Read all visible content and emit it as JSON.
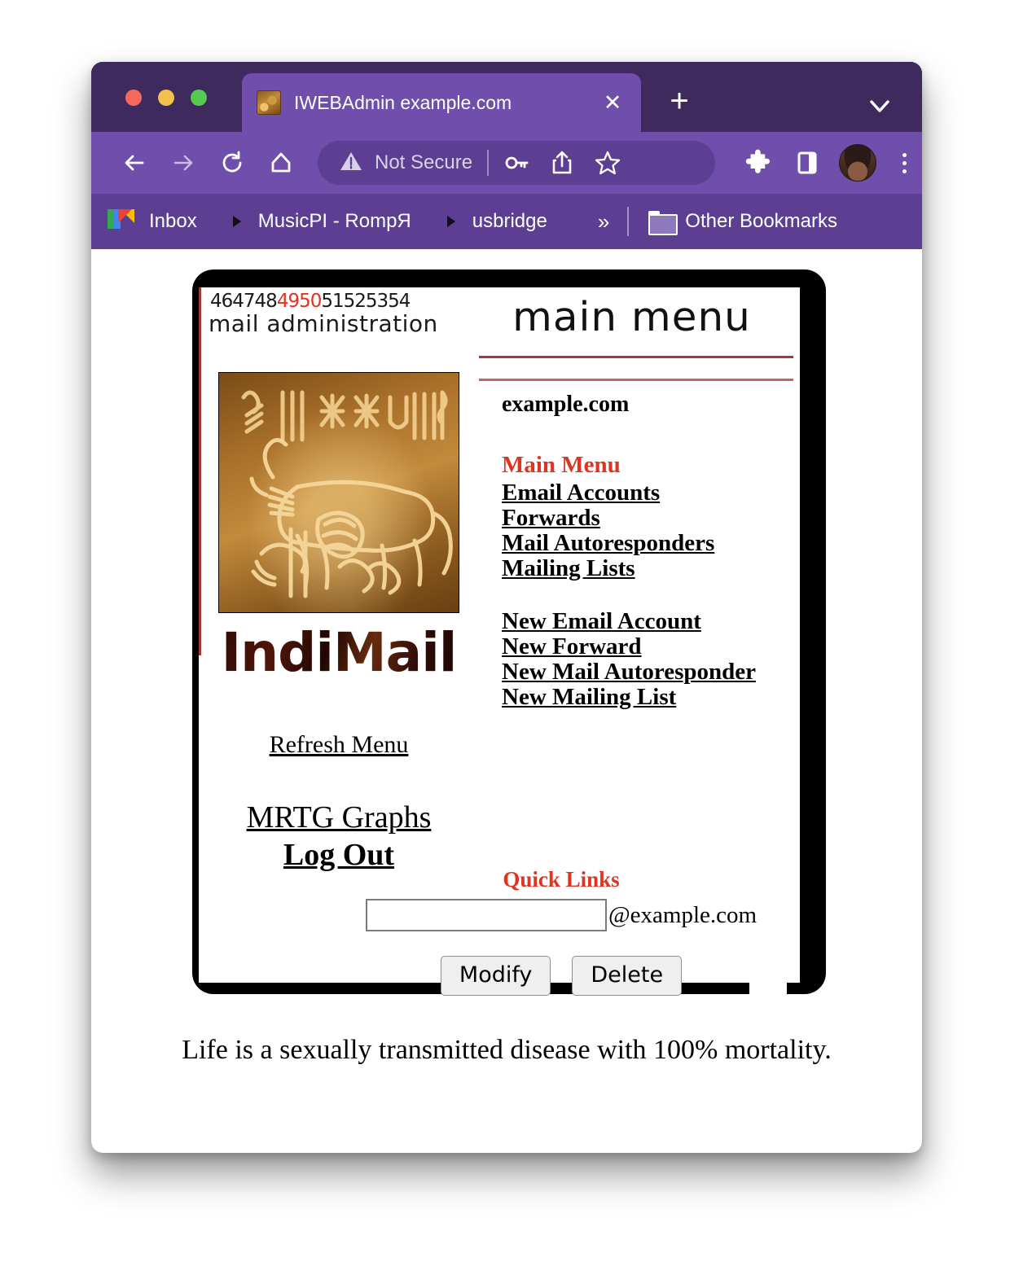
{
  "browser": {
    "tab": {
      "title": "IWEBAdmin example.com",
      "favicon_name": "indus-seal-favicon",
      "close_label": "✕",
      "new_tab_label": "+"
    },
    "toolbar": {
      "security_label": "Not Secure",
      "back_name": "back-button",
      "forward_name": "forward-button",
      "reload_name": "reload-button",
      "home_name": "home-button"
    },
    "bookmarks": [
      {
        "label": "Inbox",
        "icon": "gmail-icon"
      },
      {
        "label": "MusicPI - RompЯ",
        "icon": "vlc-icon"
      },
      {
        "label": "usbridge",
        "icon": "vlc-icon"
      }
    ],
    "bookmarks_overflow": "»",
    "other_bookmarks": "Other Bookmarks",
    "colors": {
      "tabstrip": "#3e2a5c",
      "toolbar": "#6f4fab",
      "bookmarks_bar": "#5c3f93",
      "omnibox": "#5c3f93"
    }
  },
  "page": {
    "header": {
      "numbers_before": "464748",
      "numbers_hot": "4950",
      "numbers_after": "51525354",
      "subtitle": "mail administration",
      "title": "main menu"
    },
    "brand": {
      "wordmark": "IndiMail",
      "seal_name": "indus-valley-seal-image"
    },
    "domain": "example.com",
    "main_menu_heading": "Main Menu",
    "menu_links": [
      "Email Accounts",
      "Forwards",
      "Mail Autoresponders",
      "Mailing Lists"
    ],
    "new_links": [
      "New Email Account",
      "New Forward",
      "New Mail Autoresponder",
      "New Mailing List"
    ],
    "refresh_link": "Refresh Menu",
    "mrtg_link": "MRTG Graphs",
    "logout_link": "Log Out",
    "quick_links": {
      "heading": "Quick Links",
      "input_value": "",
      "input_placeholder": "",
      "suffix": "@example.com",
      "modify_label": "Modify",
      "delete_label": "Delete"
    },
    "footer_quote": "Life is a sexually transmitted disease with 100% mortality.",
    "colors": {
      "accent_red": "#e03423",
      "rule_red": "#a33b33",
      "frame_black": "#000000"
    }
  }
}
